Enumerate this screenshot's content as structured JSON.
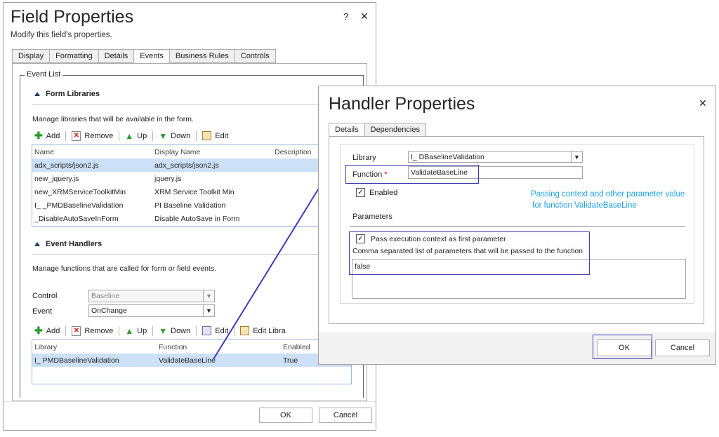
{
  "field_properties": {
    "title": "Field Properties",
    "subtitle": "Modify this field's properties.",
    "help_label": "?",
    "close_label": "✕",
    "tabs": [
      "Display",
      "Formatting",
      "Details",
      "Events",
      "Business Rules",
      "Controls"
    ],
    "event_list_legend": "Event List",
    "form_libraries": {
      "heading": "Form Libraries",
      "description": "Manage libraries that will be available in the form.",
      "toolbar": {
        "add": "Add",
        "remove": "Remove",
        "up": "Up",
        "down": "Down",
        "edit": "Edit"
      },
      "columns": [
        "Name",
        "Display Name",
        "Description"
      ],
      "rows": [
        {
          "name": "adx_scripts/json2.js",
          "display": "adx_scripts/json2.js"
        },
        {
          "name": "new_jquery.js",
          "display": "jquery.js"
        },
        {
          "name": "new_XRMServiceToolkitMin",
          "display": "XRM Service Toolkit Min"
        },
        {
          "name": "I_ _PMDBaselineValidation",
          "display": "PI Baseline Validation"
        },
        {
          "name": "_DisableAutoSaveInForm",
          "display": "Disable AutoSave in Form"
        }
      ]
    },
    "event_handlers": {
      "heading": "Event Handlers",
      "description": "Manage functions that are called for form or field events.",
      "control_label": "Control",
      "control_value": "Baseline",
      "event_label": "Event",
      "event_value": "OnChange",
      "toolbar": {
        "add": "Add",
        "remove": "Remove",
        "up": "Up",
        "down": "Down",
        "edit": "Edit",
        "edit_library": "Edit Libra"
      },
      "columns": [
        "Library",
        "Function",
        "Enabled"
      ],
      "rows": [
        {
          "library": "I_ PMDBaselineValidation",
          "function": "ValidateBaseLine",
          "enabled": "True"
        }
      ]
    },
    "ok_label": "OK",
    "cancel_label": "Cancel"
  },
  "handler_properties": {
    "title": "Handler Properties",
    "close_label": "✕",
    "tabs": [
      "Details",
      "Dependencies"
    ],
    "library_label": "Library",
    "library_value": "I_ DBaselineValidation",
    "function_label": "Function",
    "required_mark": "*",
    "function_value": "ValidateBaseLine",
    "enabled_label": "Enabled",
    "parameters_label": "Parameters",
    "pass_context_label": "Pass execution context as first parameter",
    "comma_list_label": "Comma separated list of parameters that will be passed to the function",
    "parameters_value": "false",
    "ok_label": "OK",
    "cancel_label": "Cancel"
  },
  "annotation": {
    "line1": "Passing context and other parameter value",
    "line2": "for function ValidateBaseLine"
  },
  "colors": {
    "highlight_box": "#3c3cb4",
    "annotation_text": "#1ba1e2",
    "selected_row": "#cce0f7",
    "tri_blue": "#1e3d6b"
  }
}
